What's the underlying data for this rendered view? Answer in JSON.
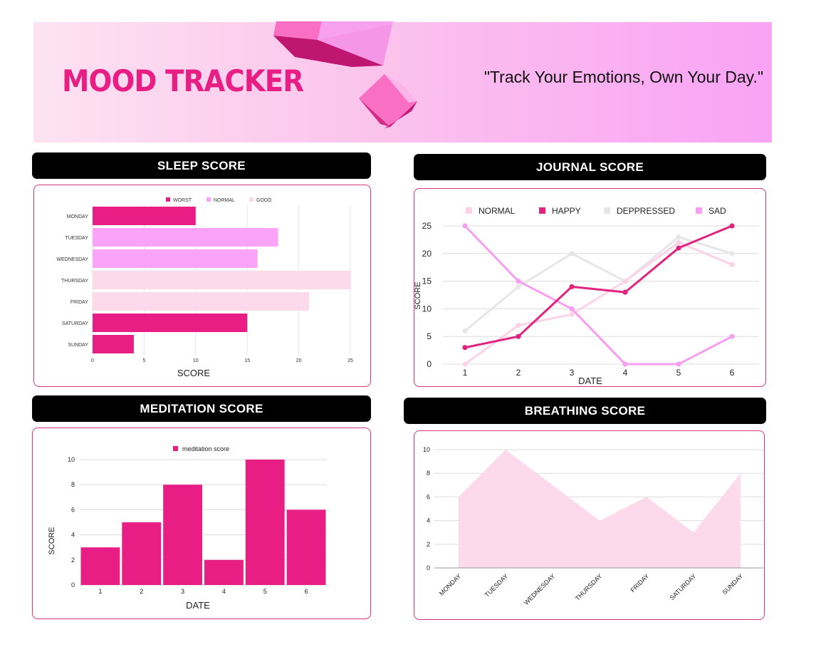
{
  "header": {
    "title": "MOOD TRACKER",
    "tagline": "\"Track Your Emotions, Own Your Day.\""
  },
  "colors": {
    "worst": "#e91e85",
    "normal": "#fba3f7",
    "good": "#fdd9ec",
    "happy": "#e0247f",
    "sad": "#f79ef2",
    "deppressed": "#e6e6e6",
    "journal_normal": "#fcd3e6",
    "breathing": "#fdd9ec",
    "panel_border": "#d9347f"
  },
  "chart_data": [
    {
      "id": "sleep",
      "section_title": "SLEEP SCORE",
      "type": "bar",
      "orientation": "horizontal",
      "categories": [
        "MONDAY",
        "TUESDAY",
        "WEDNESDAY",
        "THURSDAY",
        "FRIDAY",
        "SATURDAY",
        "SUNDAY"
      ],
      "values": [
        10,
        18,
        16,
        25,
        21,
        15,
        4
      ],
      "category_class": [
        "WORST",
        "NORMAL",
        "NORMAL",
        "GOOD",
        "GOOD",
        "WORST",
        "WORST"
      ],
      "legend": [
        "WORST",
        "NORMAL",
        "GOOD"
      ],
      "legend_position": "top",
      "xlabel": "SCORE",
      "ylabel": "",
      "xlim": [
        0,
        25
      ],
      "xticks": [
        "0",
        "5",
        "10",
        "15",
        "20",
        "25"
      ],
      "grid": true
    },
    {
      "id": "journal",
      "section_title": "JOURNAL SCORE",
      "type": "line",
      "x": [
        "1",
        "2",
        "3",
        "4",
        "5",
        "6"
      ],
      "series": [
        {
          "name": "NORMAL",
          "values": [
            0,
            7,
            9,
            15,
            22,
            18
          ]
        },
        {
          "name": "HAPPY",
          "values": [
            3,
            5,
            14,
            13,
            21,
            25
          ]
        },
        {
          "name": "DEPPRESSED",
          "values": [
            6,
            14,
            20,
            15,
            23,
            20
          ]
        },
        {
          "name": "SAD",
          "values": [
            25,
            15,
            10,
            0,
            0,
            5
          ]
        }
      ],
      "legend_position": "top",
      "xlabel": "DATE",
      "ylabel": "SCORE",
      "ylim": [
        0,
        25
      ],
      "yticks": [
        "0",
        "5",
        "10",
        "15",
        "20",
        "25"
      ],
      "grid": true
    },
    {
      "id": "meditation",
      "section_title": "MEDITATION SCORE",
      "type": "bar",
      "categories": [
        "1",
        "2",
        "3",
        "4",
        "5",
        "6"
      ],
      "series": [
        {
          "name": "meditation score",
          "values": [
            3,
            5,
            8,
            2,
            10,
            6
          ]
        }
      ],
      "legend_position": "top",
      "xlabel": "DATE",
      "ylabel": "SCORE",
      "ylim": [
        0,
        10
      ],
      "yticks": [
        "0",
        "2",
        "4",
        "6",
        "8",
        "10"
      ],
      "grid": true
    },
    {
      "id": "breathing",
      "section_title": "BREATHING SCORE",
      "type": "area",
      "categories": [
        "MONDAY",
        "TUESDAY",
        "WEDNESDAY",
        "THURSDAY",
        "FRIDAY",
        "SATURDAY",
        "SUNDAY"
      ],
      "values": [
        6,
        10,
        7,
        4,
        6,
        3,
        8
      ],
      "xlabel": "",
      "ylabel": "",
      "ylim": [
        0,
        10
      ],
      "yticks": [
        "0",
        "2",
        "4",
        "6",
        "8",
        "10"
      ],
      "grid": true
    }
  ]
}
